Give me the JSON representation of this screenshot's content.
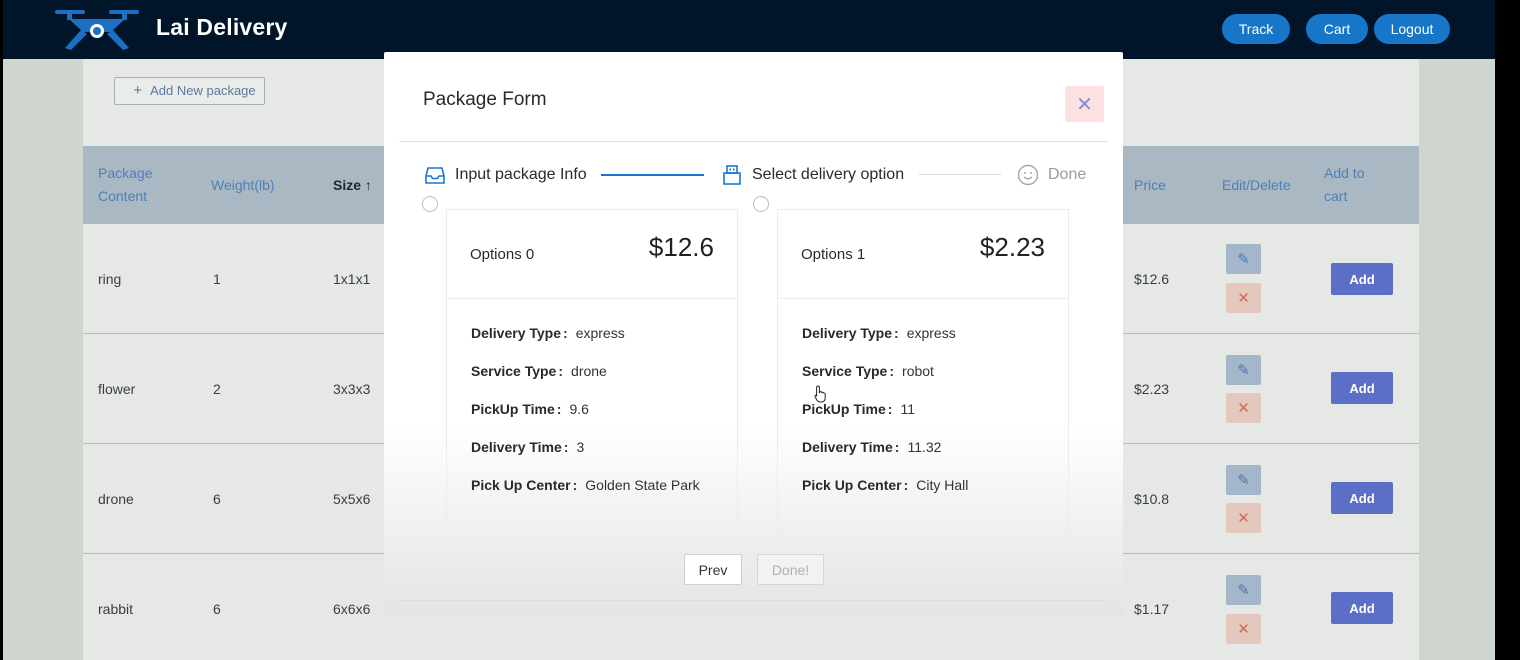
{
  "app": {
    "brand": "Lai Delivery",
    "nav": {
      "track": "Track",
      "cart": "Cart",
      "logout": "Logout"
    }
  },
  "page": {
    "add_package": "Add New package",
    "columns": {
      "content": "Package Content",
      "weight": "Weight(lb)",
      "size": "Size ↑",
      "price": "Price",
      "edit_delete": "Edit/Delete",
      "add_to_cart": "Add to cart"
    },
    "rows": [
      {
        "content": "ring",
        "weight": "1",
        "size": "1x1x1",
        "price": "$12.6"
      },
      {
        "content": "flower",
        "weight": "2",
        "size": "3x3x3",
        "price": "$2.23"
      },
      {
        "content": "drone",
        "weight": "6",
        "size": "5x5x6",
        "price": "$10.8"
      },
      {
        "content": "rabbit",
        "weight": "6",
        "size": "6x6x6",
        "price": "$1.17"
      }
    ],
    "row_add_label": "Add",
    "peek_text": "park"
  },
  "modal": {
    "title": "Package Form",
    "steps": [
      "Input package Info",
      "Select delivery option",
      "Done"
    ],
    "labels": {
      "delivery_type": "Delivery Type",
      "service_type": "Service Type",
      "pickup_time": "PickUp Time",
      "delivery_time": "Delivery Time",
      "pickup_center": "Pick Up Center",
      "sep": ":"
    },
    "options": [
      {
        "title": "Options 0",
        "price": "$12.6",
        "delivery_type": "express",
        "service_type": "drone",
        "pickup_time": "9.6",
        "delivery_time": "3",
        "pickup_center": "Golden State Park"
      },
      {
        "title": "Options 1",
        "price": "$2.23",
        "delivery_type": "express",
        "service_type": "robot",
        "pickup_time": "11",
        "delivery_time": "11.32",
        "pickup_center": "City Hall"
      }
    ],
    "buttons": {
      "prev": "Prev",
      "done": "Done!"
    }
  },
  "colors": {
    "header": "#001529",
    "accent": "#1876c8",
    "add_button": "#5c6fc7"
  }
}
